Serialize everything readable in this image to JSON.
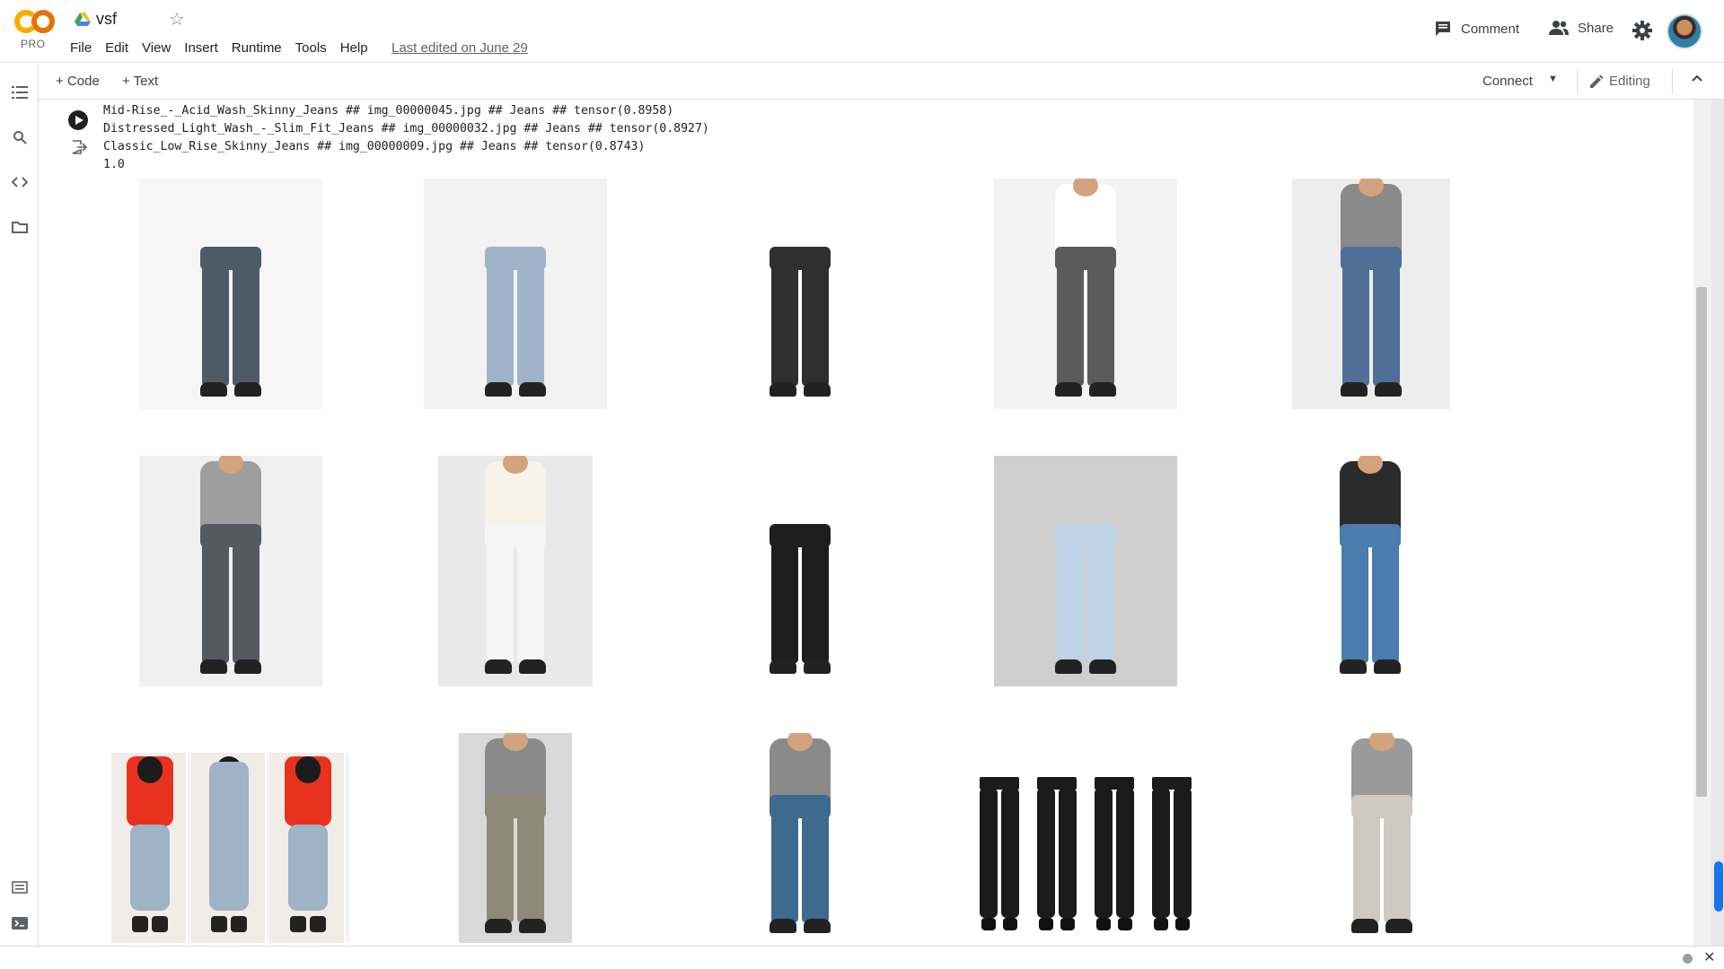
{
  "header": {
    "logo_text": "CO",
    "logo_badge": "PRO",
    "notebook_title": "vsf",
    "menu": [
      "File",
      "Edit",
      "View",
      "Insert",
      "Runtime",
      "Tools",
      "Help"
    ],
    "last_edited": "Last edited on June 29",
    "comment_label": "Comment",
    "share_label": "Share"
  },
  "toolbar": {
    "add_code": "+ Code",
    "add_text": "+ Text",
    "connect": "Connect",
    "editing": "Editing"
  },
  "cell": {
    "output_lines": [
      "Mid-Rise_-_Acid_Wash_Skinny_Jeans ## img_00000045.jpg ## Jeans ## tensor(0.8958)",
      "Distressed_Light_Wash_-_Slim_Fit_Jeans ## img_00000032.jpg ## Jeans ## tensor(0.8927)",
      "Classic_Low_Rise_Skinny_Jeans ## img_00000009.jpg ## Jeans ## tensor(0.8743)",
      "1.0"
    ]
  },
  "images": [
    {
      "name": "dark-grey-skinny-jeans-photo",
      "bg": "#f6f6f6",
      "jean": "#4d5b66"
    },
    {
      "name": "light-acid-wash-jeans-photo",
      "bg": "#f2f2f2",
      "jean": "#9fb3c8"
    },
    {
      "name": "black-faded-jeans-photo",
      "bg": "#ffffff",
      "jean": "#2f2f2f"
    },
    {
      "name": "grey-acid-wash-ripped-jeans-photo",
      "bg": "#f3f3f3",
      "jean": "#5b5b5b"
    },
    {
      "name": "mens-blue-jeans-photo",
      "bg": "#ededed",
      "jean": "#4f6f96"
    },
    {
      "name": "grey-skinny-jeans-walking-photo",
      "bg": "#f0f0f0",
      "jean": "#555a60"
    },
    {
      "name": "white-cropped-jeans-photo",
      "bg": "#e9e9e9",
      "jean": "#f5f5f5"
    },
    {
      "name": "black-skinny-jeans-heels-photo",
      "bg": "#ffffff",
      "jean": "#1e1e1e"
    },
    {
      "name": "light-distressed-jeans-photo",
      "bg": "#cfcfcf",
      "jean": "#bfd4e6"
    },
    {
      "name": "medium-blue-skinny-jeans-photo",
      "bg": "#ffffff",
      "jean": "#4a7cad"
    },
    {
      "name": "acid-wash-mom-jeans-collage-photo",
      "bg": "#f4f4f4",
      "jean": "#9fb2c6"
    },
    {
      "name": "mens-grey-jeans-photo",
      "bg": "#d9d9d9",
      "jean": "#8d8a78"
    },
    {
      "name": "mens-blue-jeans-tshirt-photo",
      "bg": "#ffffff",
      "jean": "#3f6a8f"
    },
    {
      "name": "black-coated-jeans-lineup-photo",
      "bg": "#ffffff",
      "jean": "#1b1b1b"
    },
    {
      "name": "camo-print-skinny-jeans-photo",
      "bg": "#ffffff",
      "jean": "#cfc9c1"
    }
  ]
}
